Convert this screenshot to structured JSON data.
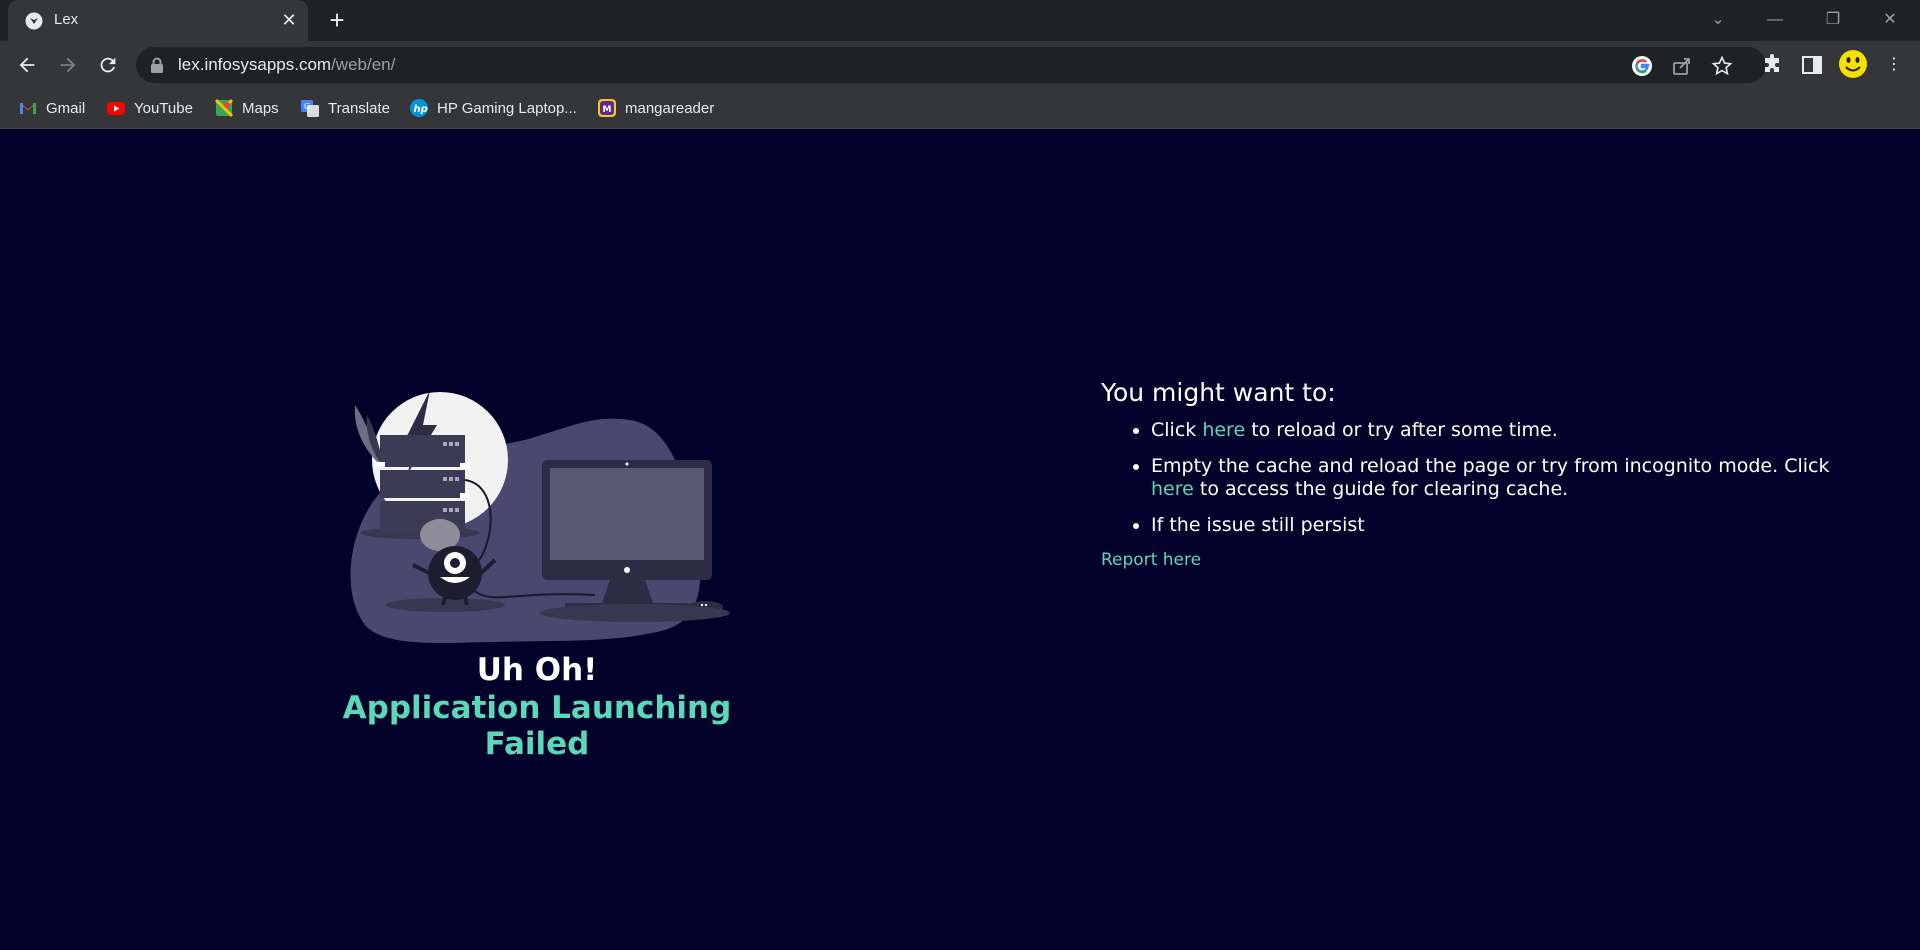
{
  "browser": {
    "tab_title": "Lex",
    "url_domain": "lex.infosysapps.com",
    "url_path": "/web/en/",
    "bookmarks": [
      {
        "label": "Gmail",
        "icon": "gmail-icon"
      },
      {
        "label": "YouTube",
        "icon": "youtube-icon"
      },
      {
        "label": "Maps",
        "icon": "maps-icon"
      },
      {
        "label": "Translate",
        "icon": "translate-icon"
      },
      {
        "label": "HP Gaming Laptop...",
        "icon": "hp-icon"
      },
      {
        "label": "mangareader",
        "icon": "mangareader-icon"
      }
    ]
  },
  "error": {
    "title": "Uh Oh!",
    "subtitle": "Application Launching Failed"
  },
  "advice": {
    "heading": "You might want to:",
    "item1_pre": "Click ",
    "item1_link": "here",
    "item1_post": " to reload or try after some time.",
    "item2_pre": "Empty the cache and reload the page or try from incognito mode. Click ",
    "item2_link": "here",
    "item2_post": " to access the guide for clearing cache.",
    "item3": "If the issue still persist",
    "report_link": "Report here"
  },
  "colors": {
    "page_background": "#01012a",
    "accent": "#5ad8b7",
    "chrome_dark": "#202124",
    "chrome_toolbar": "#35363a"
  }
}
